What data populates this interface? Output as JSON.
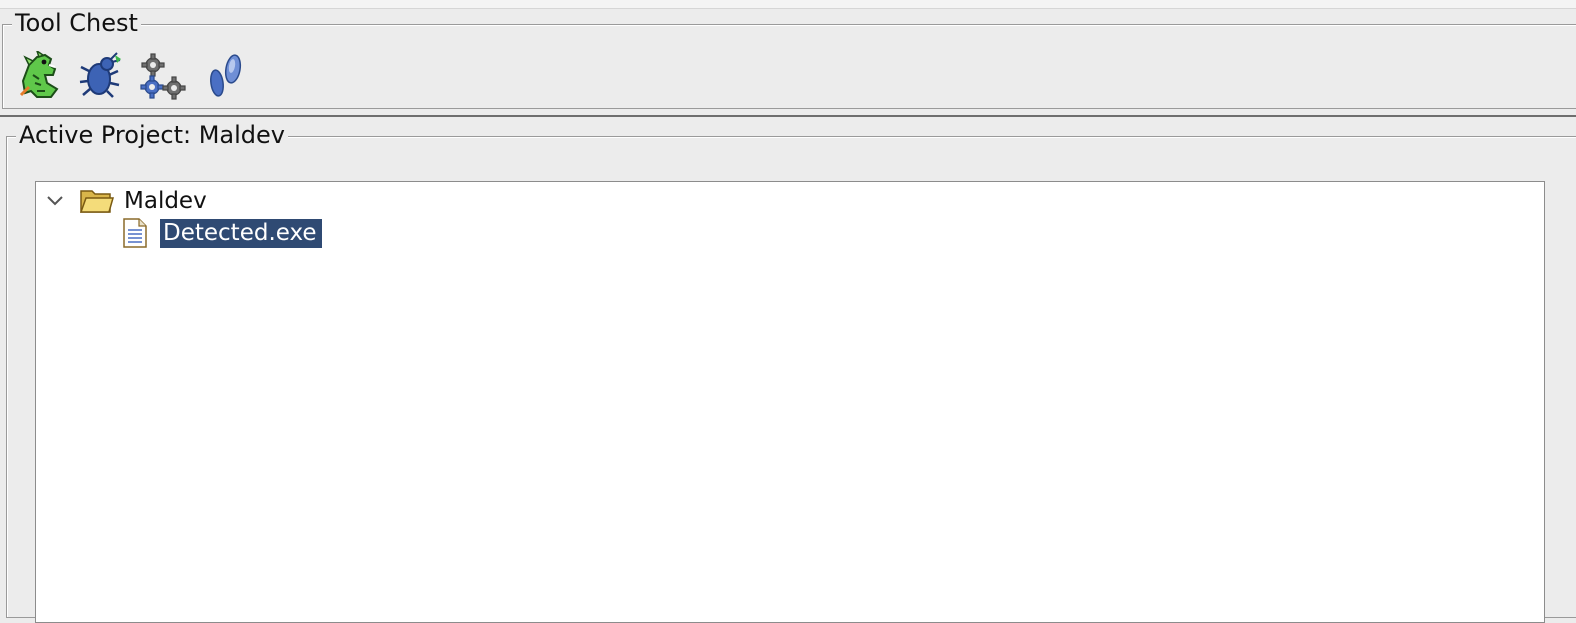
{
  "tool_chest": {
    "title": "Tool Chest",
    "tools": [
      {
        "name": "code-browser",
        "icon": "dragon-icon"
      },
      {
        "name": "debugger",
        "icon": "bug-icon"
      },
      {
        "name": "version-tracking",
        "icon": "gears-icon"
      },
      {
        "name": "emulator",
        "icon": "footprints-icon"
      }
    ]
  },
  "project": {
    "title": "Active Project: Maldev",
    "tree": {
      "root": {
        "label": "Maldev",
        "expanded": true,
        "icon": "folder-open-icon"
      },
      "children": [
        {
          "label": "Detected.exe",
          "selected": true,
          "icon": "file-icon"
        }
      ]
    }
  },
  "colors": {
    "selection": "#2f4a73",
    "panel_bg": "#ececec",
    "tree_bg": "#ffffff"
  }
}
